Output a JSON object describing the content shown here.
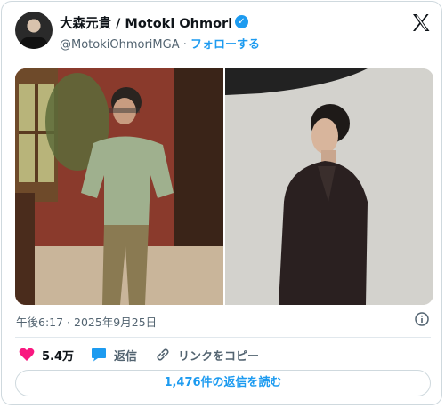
{
  "author": {
    "display_name": "大森元貴 / Motoki Ohmori",
    "handle": "@MotokiOhmoriMGA",
    "separator": " · ",
    "follow_label": "フォローする"
  },
  "platform_icon": "x-logo-icon",
  "timestamp": "午後6:17 · 2025年9月25日",
  "actions": {
    "like_count": "5.4万",
    "reply_label": "返信",
    "copy_link_label": "リンクをコピー"
  },
  "read_replies_label": "1,476件の返信を読む",
  "colors": {
    "accent": "#1d9bf0",
    "like": "#f91880",
    "text_secondary": "#536471",
    "border": "#cfd9de"
  }
}
